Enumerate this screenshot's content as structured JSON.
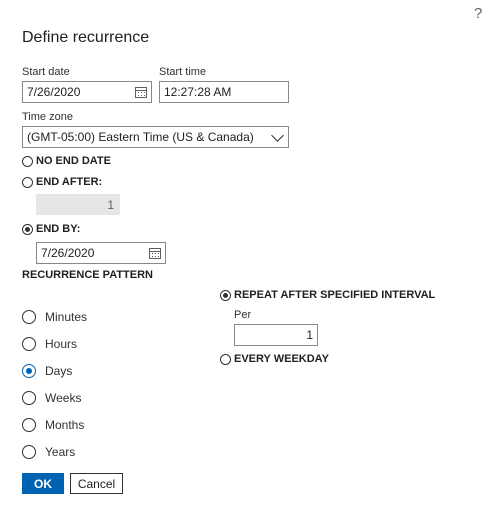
{
  "dialog": {
    "help_icon": "?",
    "title": "Define recurrence"
  },
  "range": {
    "start_date_label": "Start date",
    "start_date_value": "7/26/2020",
    "start_time_label": "Start time",
    "start_time_value": "12:27:28 AM",
    "time_zone_label": "Time zone",
    "time_zone_value": "(GMT-05:00) Eastern Time (US & Canada)",
    "end_options": {
      "no_end_date": "NO END DATE",
      "end_after": "END AFTER:",
      "end_after_count": "1",
      "end_by": "END BY:",
      "end_by_value": "7/26/2020",
      "selected": "end_by"
    }
  },
  "pattern": {
    "heading": "RECURRENCE PATTERN",
    "units": [
      "Minutes",
      "Hours",
      "Days",
      "Weeks",
      "Months",
      "Years"
    ],
    "selected_unit": "Days",
    "repeat_after_label": "REPEAT AFTER SPECIFIED INTERVAL",
    "per_label": "Per",
    "per_value": "1",
    "every_weekday_label": "EVERY WEEKDAY",
    "selected_mode": "repeat_after"
  },
  "actions": {
    "ok_label": "OK",
    "cancel_label": "Cancel"
  },
  "colors": {
    "accent": "#0063b1",
    "disabled_bg": "#e6e6e6",
    "border": "#8a8886"
  },
  "icons": [
    "help-icon",
    "calendar-icon",
    "chevron-down-icon"
  ]
}
